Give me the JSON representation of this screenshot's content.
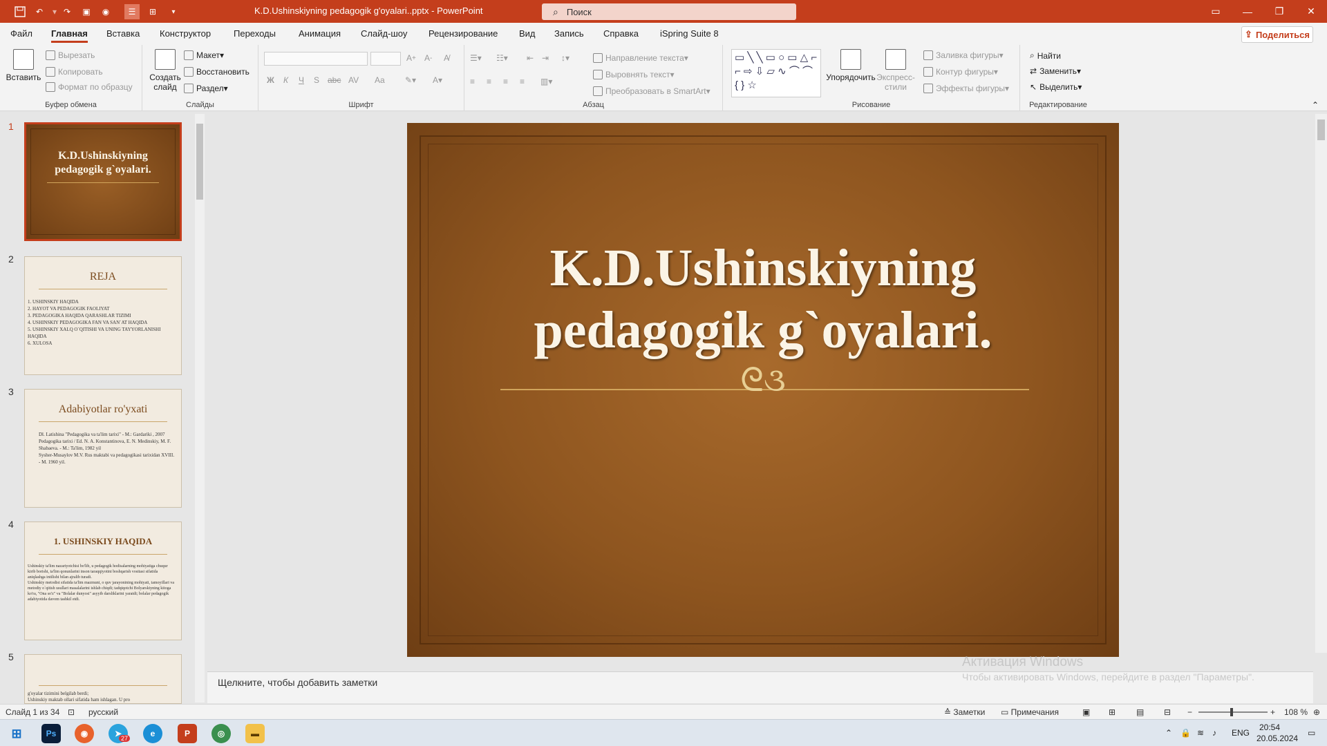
{
  "window": {
    "title": "K.D.Ushinskiyning pedagogik g'oyalari..pptx - PowerPoint",
    "search_placeholder": "Поиск"
  },
  "tabs": [
    "Файл",
    "Главная",
    "Вставка",
    "Конструктор",
    "Переходы",
    "Анимация",
    "Слайд-шоу",
    "Рецензирование",
    "Вид",
    "Запись",
    "Справка",
    "iSpring Suite 8"
  ],
  "share_label": "Поделиться",
  "ribbon": {
    "clipboard": {
      "paste": "Вставить",
      "cut": "Вырезать",
      "copy": "Копировать",
      "format": "Формат по образцу",
      "label": "Буфер обмена"
    },
    "slides": {
      "new_slide": "Создать слайд",
      "layout": "Макет",
      "reset": "Восстановить",
      "section": "Раздел",
      "label": "Слайды"
    },
    "font": {
      "label": "Шрифт",
      "bold": "Ж",
      "italic": "К",
      "underline": "Ч",
      "shadow": "S",
      "strike": "abc",
      "spacing": "AV",
      "case": "Aa"
    },
    "paragraph": {
      "label": "Абзац",
      "direction": "Направление текста",
      "align": "Выровнять текст",
      "smartart": "Преобразовать в SmartArt"
    },
    "drawing": {
      "label": "Рисование",
      "arrange": "Упорядочить",
      "quick_styles": "Экспресс-стили",
      "fill": "Заливка фигуры",
      "outline": "Контур фигуры",
      "effects": "Эффекты фигуры"
    },
    "editing": {
      "label": "Редактирование",
      "find": "Найти",
      "replace": "Заменить",
      "select": "Выделить"
    }
  },
  "thumbnails": [
    {
      "num": "1",
      "title": "K.D.Ushinskiyning pedagogik g`oyalari.",
      "lines": []
    },
    {
      "num": "2",
      "title": "REJA",
      "lines": [
        "1. USHINSKIY HAQIDA",
        "2. HAYOT VA PEDAGOGIK FAOLIYAT",
        "3. PEDAGOGIKA HAQIDA QARASHLAR TIZIMI",
        "4. USHINSKIY PEDAGOGIKA FAN VA SAN`AT HAQIDA",
        "5. USHINSKIY XALQ O`QITISHI VA UNING TAYYORLANISHI HAQIDA",
        "6. XULOSA"
      ]
    },
    {
      "num": "3",
      "title": "Adabiyotlar ro'yxati",
      "lines": [
        "Dl. Latishina \"Pedagogika va ta'lim tarixi\" - M.: Gardariki , 2007",
        "Pedagogika tarixi / Ed. N. A. Konstantinova, E. N. Medinskiy, M. F. Shabaeva. - M.: Ta'lim, 1982 yil",
        "Sysher-Musaylov M.V. Rus maktabi va pedagogikasi tarixidan XVIII. - M. 1960 yil."
      ]
    },
    {
      "num": "4",
      "title": "1. USHINSKIY HAQIDA",
      "lines": [
        "Ushinskiy ta'lim nazariyotchisi bo'lib, u pedagogik hodisalarning mohiyatiga chuqur kirib borishi, ta'lim qonunlarini inson taraqqiyotini boshqarish vositasi sifatida aniqlashga intilishi bilan ajralib turadi.",
        "Ushinskiy metodist sifatida ta'lim mazmuni, o quv jarayonining mohiyati, tamoyillari va metodiy o`qitish usullari masalalarini ishlab chiqdi; tadqiqotchi Bolyarskiyning kitoga ko'ra, \"Ona so'z\" va \"Bolalar dunyosi\" asyyib darsliklarini yaratdi; bolalar pedagogik adabiyotida davom tashkil etdi."
      ]
    },
    {
      "num": "5",
      "title": "",
      "lines": [
        "g'oyalar tizimini belgilab berdi;",
        "Ushinskiy maktab ollari sifatida ham ishlagan. U pro"
      ]
    }
  ],
  "slide": {
    "title_line1": "K.D.Ushinskiyning",
    "title_line2": "pedagogik g`oyalari.",
    "ornament": "ᘓ૩"
  },
  "notes_placeholder": "Щелкните, чтобы добавить заметки",
  "watermark": {
    "title": "Активация Windows",
    "text": "Чтобы активировать Windows, перейдите в раздел \"Параметры\"."
  },
  "status": {
    "slide_counter": "Слайд 1 из 34",
    "language": "русский",
    "notes": "Заметки",
    "comments": "Примечания",
    "zoom": "108 %"
  },
  "taskbar": {
    "time": "20:54",
    "date": "20.05.2024",
    "lang": "ENG",
    "telegram_badge": "27"
  },
  "colors": {
    "accent": "#c43e1c",
    "slide_bg": "#8e551f"
  }
}
